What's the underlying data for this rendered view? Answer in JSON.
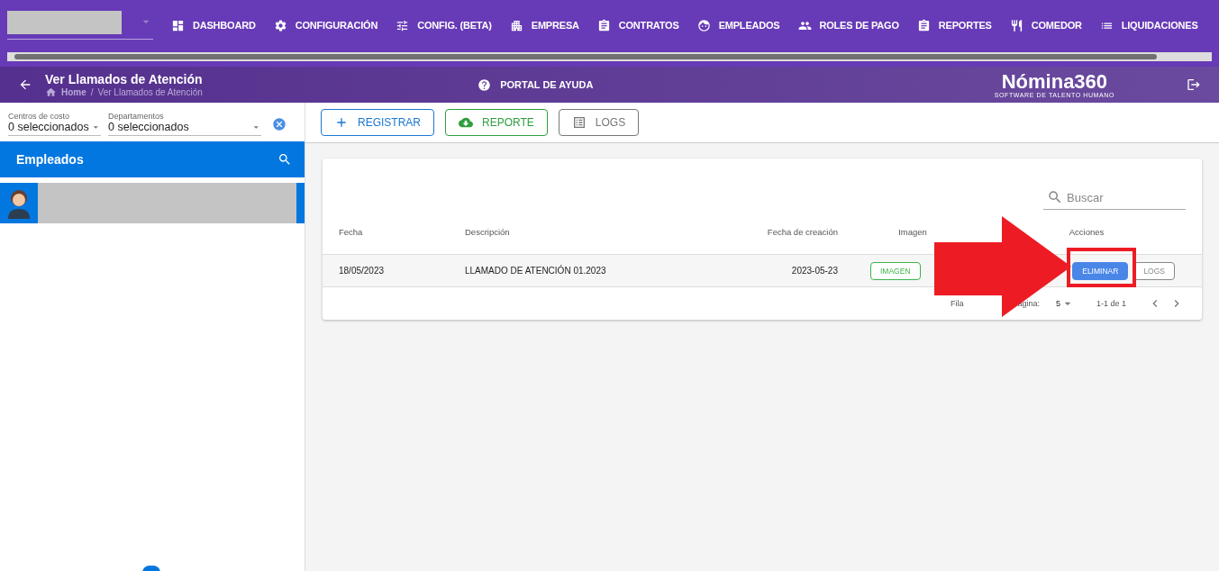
{
  "nav": [
    {
      "kind": "dashboard",
      "label": "DASHBOARD"
    },
    {
      "kind": "gear",
      "label": "CONFIGURACIÓN"
    },
    {
      "kind": "sliders",
      "label": "CONFIG. (BETA)"
    },
    {
      "kind": "building",
      "label": "EMPRESA"
    },
    {
      "kind": "clipboard",
      "label": "CONTRATOS"
    },
    {
      "kind": "face",
      "label": "EMPLEADOS"
    },
    {
      "kind": "people",
      "label": "ROLES DE PAGO"
    },
    {
      "kind": "clipboard",
      "label": "REPORTES"
    },
    {
      "kind": "utensils",
      "label": "COMEDOR"
    },
    {
      "kind": "list",
      "label": "LIQUIDACIONES"
    }
  ],
  "header": {
    "title": "Ver Llamados de Atención",
    "breadcrumb": [
      "Home",
      "Ver Llamados de Atención"
    ],
    "breadcrumb_separator": "/",
    "help": "PORTAL DE AYUDA",
    "logo": "Nómina360",
    "tagline": "SOFTWARE DE TALENTO HUMANO"
  },
  "filters": [
    {
      "label": "Centros de costo",
      "value": "0 seleccionados"
    },
    {
      "label": "Departamentos",
      "value": "0 seleccionados"
    }
  ],
  "sidebar": {
    "title": "Empleados",
    "employees": [
      {
        "selected": true
      }
    ]
  },
  "toolbar": [
    {
      "kind": "add",
      "label": "REGISTRAR"
    },
    {
      "kind": "report",
      "label": "REPORTE"
    },
    {
      "kind": "logs",
      "label": "LOGS"
    }
  ],
  "table": {
    "search_placeholder": "Buscar",
    "columns": [
      "Fecha",
      "Descripción",
      "Fecha de creación",
      "Imagen",
      "Acciones"
    ],
    "rows": [
      {
        "fecha": "18/05/2023",
        "descripcion": "LLAMADO DE ATENCIÓN 01.2023",
        "creacion": "2023-05-23",
        "imagen": "IMAGEN",
        "actions": [
          "ELIMINAR",
          "LOGS"
        ]
      }
    ],
    "rows_label_parts": [
      "Fila",
      "agina:"
    ],
    "rows_per_page": "5",
    "range": "1-1 de 1"
  }
}
